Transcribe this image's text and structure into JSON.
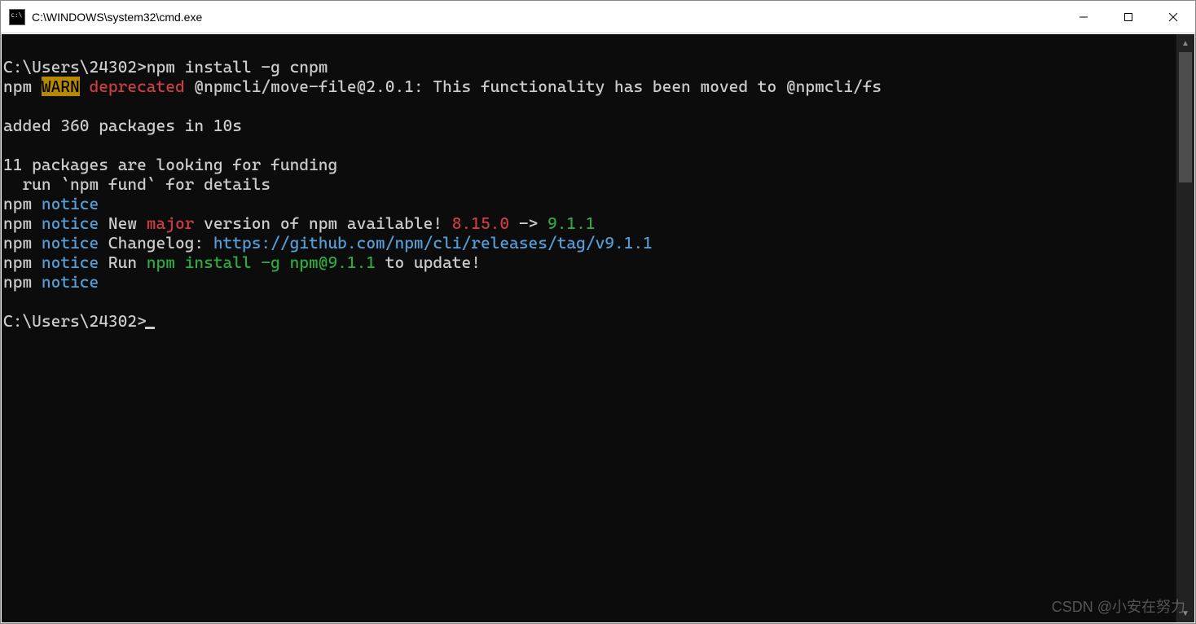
{
  "window": {
    "title": "C:\\WINDOWS\\system32\\cmd.exe"
  },
  "prompt": {
    "path1": "C:\\Users\\24302>",
    "cmd1": "npm install -g cnpm",
    "path2": "C:\\Users\\24302>"
  },
  "line_warn": {
    "npm": "npm ",
    "warn": "WARN",
    "sp": " ",
    "depr": "deprecated",
    "rest": " @npmcli/move-file@2.0.1: This functionality has been moved to @npmcli/fs"
  },
  "line_added": "added 360 packages in 10s",
  "line_funding1": "11 packages are looking for funding",
  "line_funding2": "  run `npm fund` for details",
  "notice": {
    "npm": "npm ",
    "kw": "notice",
    "l1_rest": "",
    "l2_a": " New ",
    "l2_major": "major",
    "l2_b": " version of npm available! ",
    "l2_old": "8.15.0",
    "l2_arrow": " -> ",
    "l2_new": "9.1.1",
    "l3_a": " Changelog: ",
    "l3_link": "https://github.com/npm/cli/releases/tag/v9.1.1",
    "l4_a": " Run ",
    "l4_cmd": "npm install -g npm@9.1.1",
    "l4_b": " to update!"
  },
  "watermark": "CSDN @小安在努力"
}
